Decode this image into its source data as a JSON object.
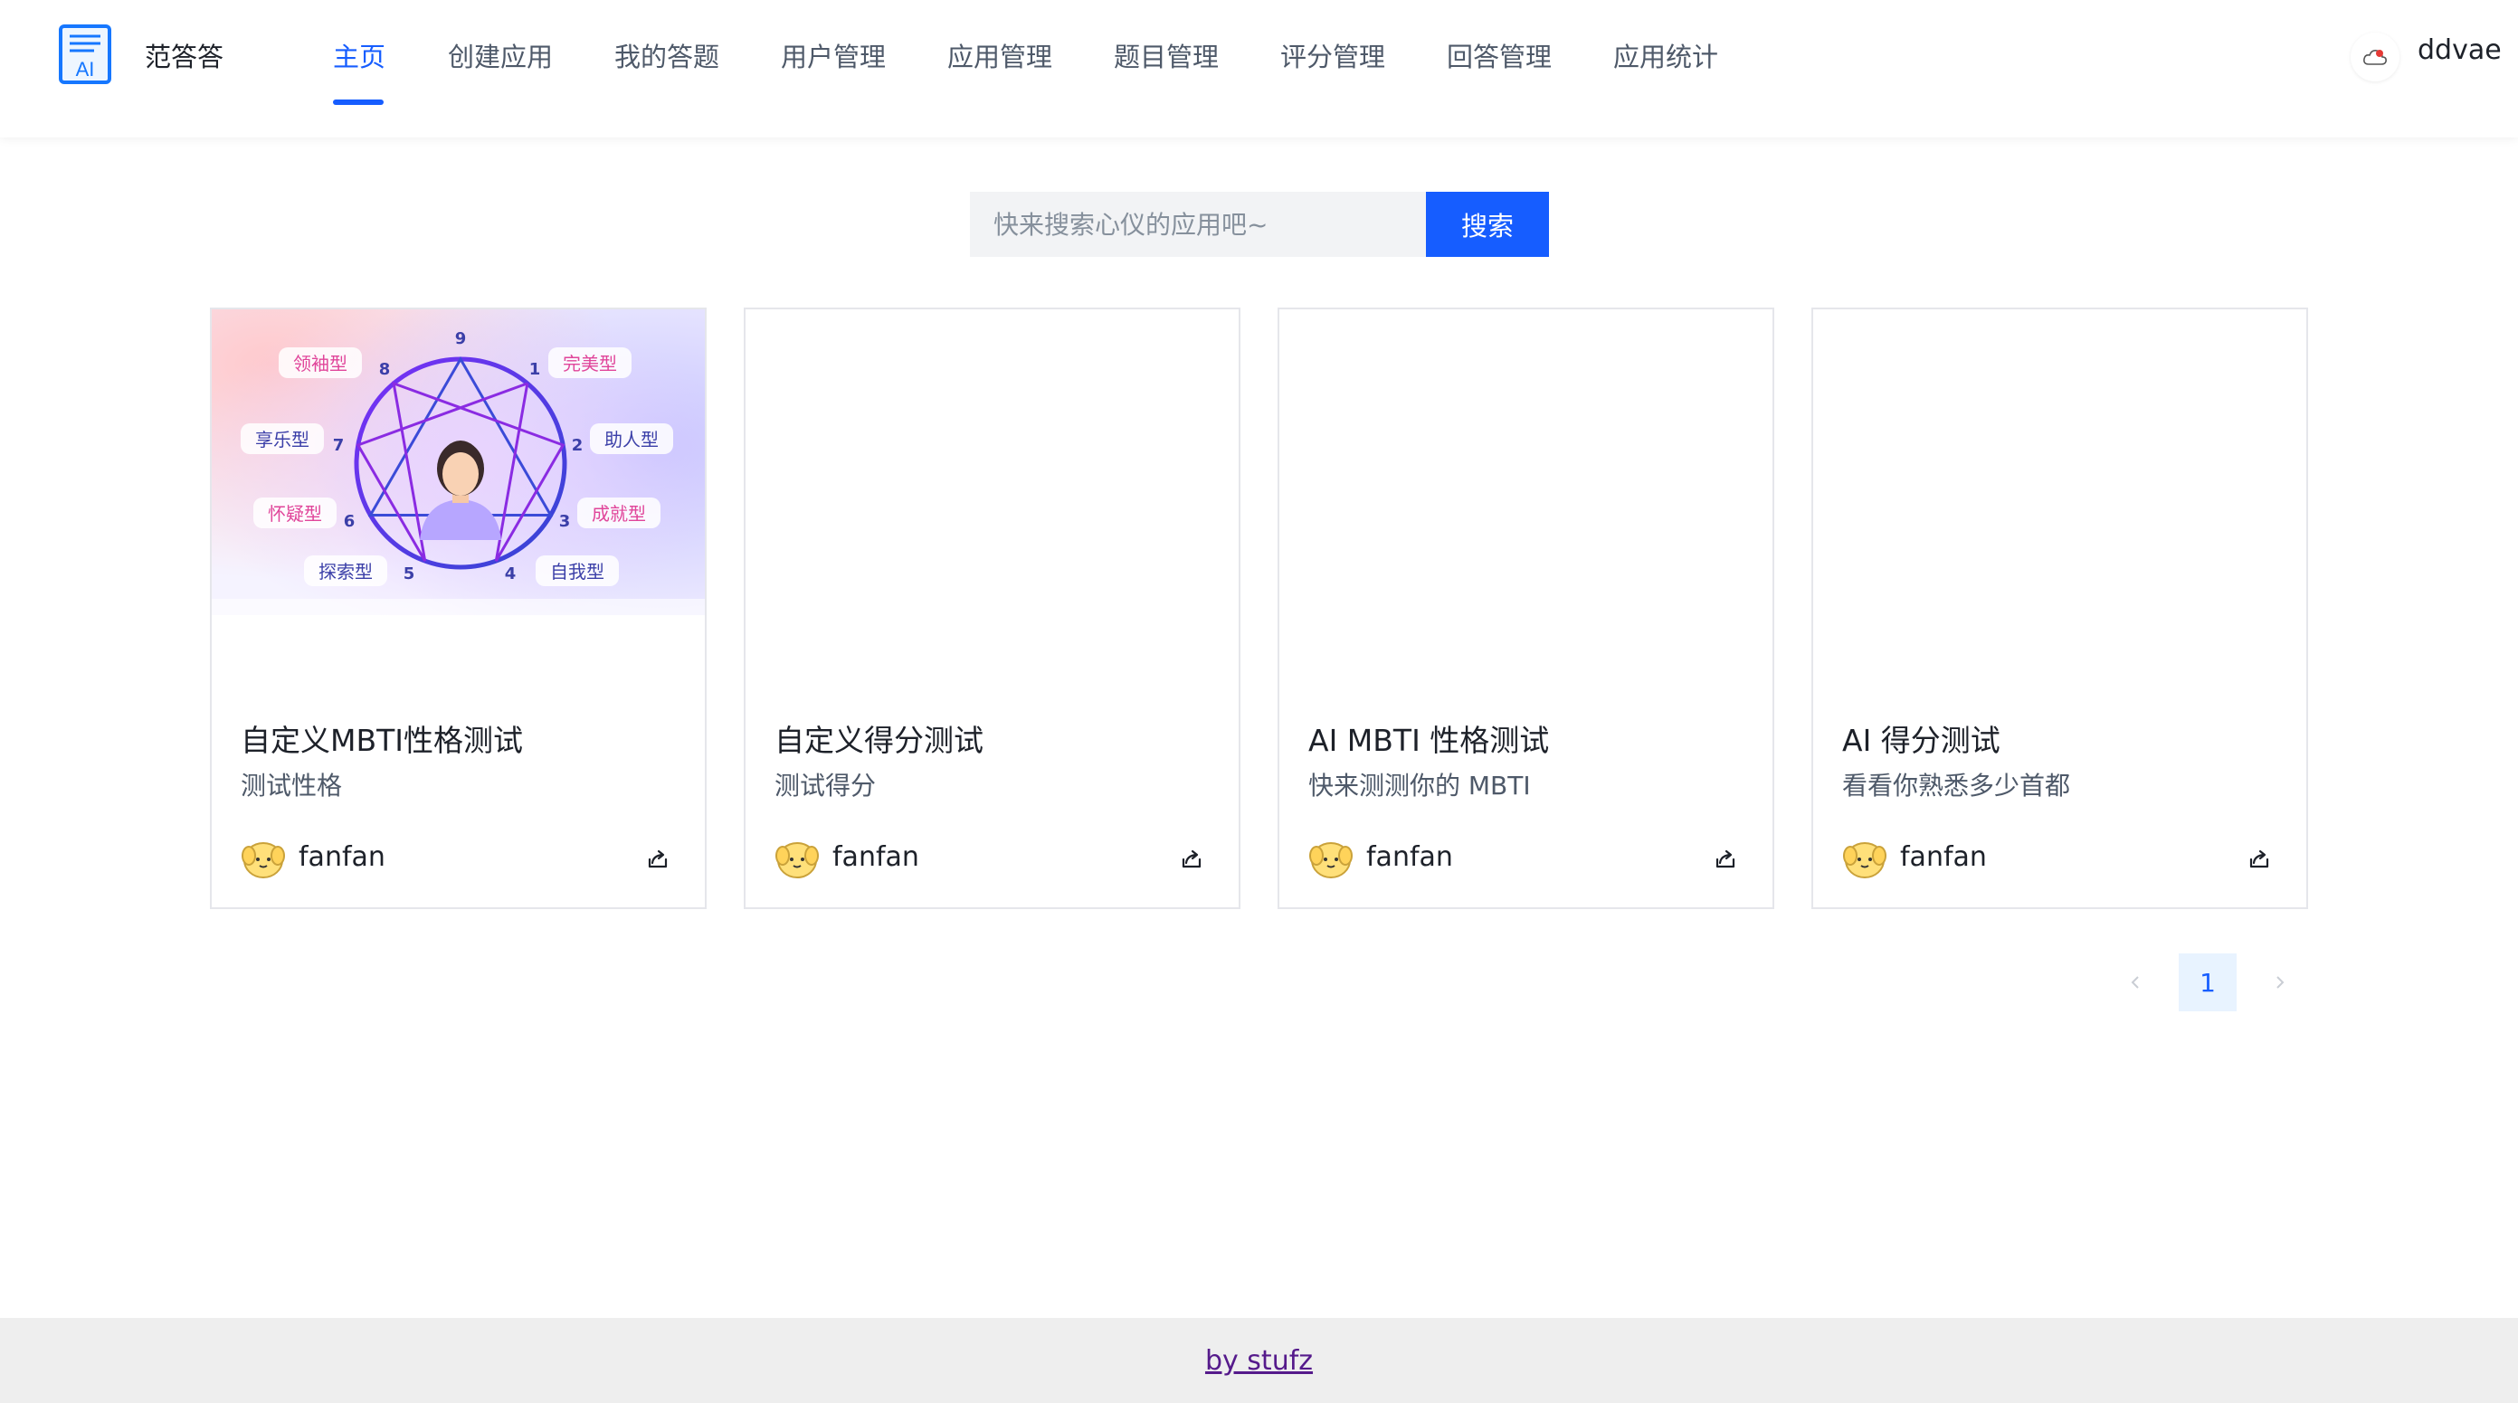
{
  "header": {
    "brand": "范答答",
    "nav": [
      {
        "label": "主页",
        "active": true
      },
      {
        "label": "创建应用"
      },
      {
        "label": "我的答题"
      },
      {
        "label": "用户管理"
      },
      {
        "label": "应用管理"
      },
      {
        "label": "题目管理"
      },
      {
        "label": "评分管理"
      },
      {
        "label": "回答管理"
      },
      {
        "label": "应用统计"
      }
    ],
    "username": "ddvae"
  },
  "search": {
    "placeholder": "快来搜索心仪的应用吧~",
    "button": "搜索"
  },
  "cards": [
    {
      "title": "自定义MBTI性格测试",
      "desc": "测试性格",
      "author": "fanfan",
      "cover": {
        "numbers": [
          "9",
          "1",
          "2",
          "3",
          "4",
          "5",
          "6",
          "7",
          "8"
        ],
        "labels": [
          "完美型",
          "助人型",
          "成就型",
          "自我型",
          "探索型",
          "怀疑型",
          "享乐型",
          "领袖型"
        ]
      }
    },
    {
      "title": "自定义得分测试",
      "desc": "测试得分",
      "author": "fanfan"
    },
    {
      "title": "AI MBTI 性格测试",
      "desc": "快来测测你的 MBTI",
      "author": "fanfan"
    },
    {
      "title": "AI 得分测试",
      "desc": "看看你熟悉多少首都",
      "author": "fanfan"
    }
  ],
  "pagination": {
    "current": "1"
  },
  "footer": {
    "text": "by stufz"
  },
  "colors": {
    "primary": "#165dff",
    "footer_bg": "#eeeeee",
    "active_page_bg": "#e8f3ff"
  },
  "icons": {
    "share": "share-icon",
    "prev": "chevron-left-icon",
    "next": "chevron-right-icon"
  }
}
